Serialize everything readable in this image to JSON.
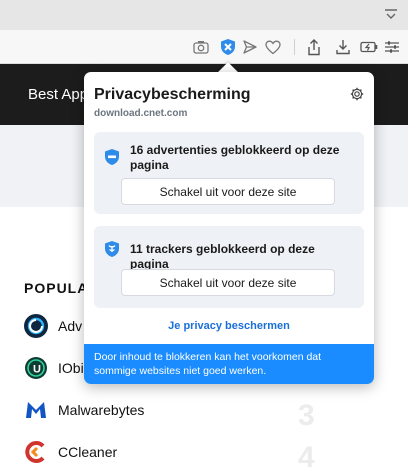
{
  "browser": {
    "toolbar_icons": [
      "camera-icon",
      "privacy-shield-icon",
      "send-icon",
      "heart-icon",
      "share-icon",
      "download-icon",
      "battery-icon",
      "settings-sliders-icon"
    ]
  },
  "page": {
    "header_text": "Best App",
    "popular_title": "POPULA",
    "apps": [
      {
        "name": "Adv",
        "logo_color": "#0d2740",
        "icon": "advanced-systemcare-logo"
      },
      {
        "name": "IObi",
        "logo_color": "#0f3b33",
        "icon": "iobit-logo"
      },
      {
        "name": "Malwarebytes",
        "logo_color": "#1256c4",
        "icon": "malwarebytes-logo"
      },
      {
        "name": "CCleaner",
        "logo_color": "#d0342c",
        "icon": "ccleaner-logo"
      }
    ],
    "rank_numbers": [
      "3",
      "4"
    ]
  },
  "popup": {
    "title": "Privacybescherming",
    "domain": "download.cnet.com",
    "ads_card": {
      "text": "16 advertenties geblokkeerd op deze pagina",
      "button": "Schakel uit voor deze site"
    },
    "trackers_card": {
      "text": "11 trackers geblokkeerd op deze pagina",
      "button": "Schakel uit voor deze site"
    },
    "protect_link": "Je privacy beschermen",
    "notice": "Door inhoud te blokkeren kan het voorkomen dat sommige websites niet goed werken."
  },
  "colors": {
    "accent_blue": "#1a8cff",
    "shield_blue": "#2f8bea",
    "link_blue": "#1a6fd8"
  }
}
